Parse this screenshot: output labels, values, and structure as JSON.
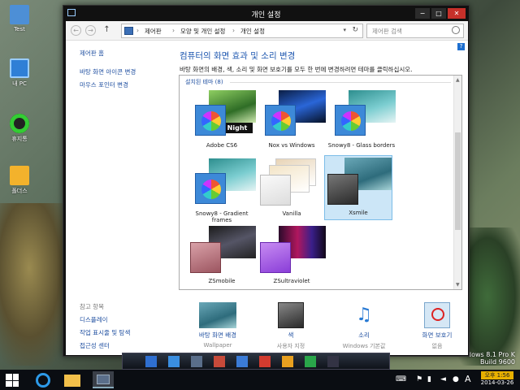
{
  "desktop": {
    "icons": [
      {
        "label": "Test"
      },
      {
        "label": "내 PC"
      },
      {
        "label": "휴지통"
      },
      {
        "label": "폴더스"
      }
    ],
    "watermark": {
      "line1": "dows 8.1 Pro K",
      "line2": "Build 9600"
    }
  },
  "window": {
    "title": "개인 설정",
    "buttons": {
      "minimize": "−",
      "maximize": "□",
      "close": "✕"
    }
  },
  "nav": {
    "back": "←",
    "forward": "→",
    "up": "↑",
    "breadcrumb": [
      "제어판",
      "모양 및 개인 설정",
      "개인 설정"
    ],
    "separator": "›",
    "dropdown": "▾",
    "refresh": "↻",
    "search_placeholder": "제어판 검색"
  },
  "left_nav": {
    "home": "제어판 홈",
    "links": [
      "바탕 화면 아이콘 변경",
      "마우스 포인터 변경"
    ],
    "see_also_header": "참고 항목",
    "see_also": [
      "디스플레이",
      "작업 표시줄 및 탐색",
      "접근성 센터"
    ]
  },
  "main": {
    "heading": "컴퓨터의 화면 효과 및 소리 변경",
    "description": "바탕 화면의 배경, 색, 소리 및 화면 보호기를 모두 한 번에 변경하려면 테마를 클릭하십시오.",
    "group_title": "설치된 테마 (8)",
    "themes": [
      {
        "name": "Adobe CS6",
        "badge": "Night",
        "selected": false
      },
      {
        "name": "Nox vs Windows",
        "selected": false
      },
      {
        "name": "Snowy8 - Glass borders",
        "selected": false
      },
      {
        "name": "Snowy8 - Gradient frames",
        "selected": false
      },
      {
        "name": "Vanilla",
        "selected": false
      },
      {
        "name": "Xsmile",
        "selected": true
      },
      {
        "name": "ZSmobile",
        "selected": false
      },
      {
        "name": "ZSultraviolet",
        "selected": false
      }
    ]
  },
  "bottom_bar": [
    {
      "label": "바탕 화면 배경",
      "sub": "Wallpaper"
    },
    {
      "label": "색",
      "sub": "사용자 지정"
    },
    {
      "label": "소리",
      "sub": "Windows 기본값"
    },
    {
      "label": "화면 보호기",
      "sub": "없음"
    }
  ],
  "taskbar": {
    "ime": "A",
    "time": "오후 1:56",
    "date": "2014-03-26"
  },
  "colors": {
    "link": "#1f4fa0",
    "heading": "#1f58b0",
    "selection": "#cce6f7",
    "close": "#c7302a"
  }
}
